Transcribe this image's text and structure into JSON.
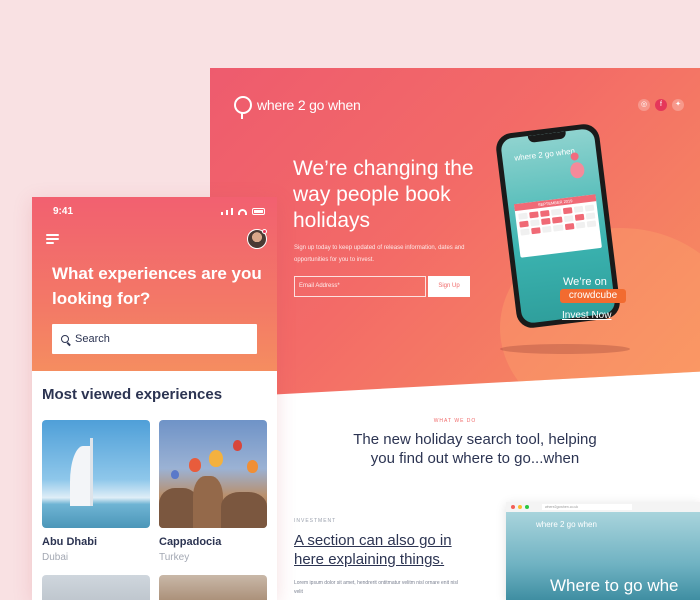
{
  "desktop": {
    "brand": "where 2 go when",
    "socials": [
      "instagram-icon",
      "facebook-icon",
      "twitter-icon"
    ],
    "hero_title": "We’re changing the way people book holidays",
    "hero_sub": "Sign up today to keep updated of release information, dates and opportunities for you to invest.",
    "email_placeholder": "Email Address*",
    "signup_label": "Sign Up",
    "phone_brand": "where 2 go when",
    "calendar_month": "SEPTEMBER 2019",
    "weare": "We’re on",
    "crowdcube": "crowdcube",
    "invest_link": "Invest Now",
    "what_label": "WHAT WE DO",
    "what_title": "The new holiday search tool, helping you find out where to go...when",
    "invest_label": "INVESTMENT",
    "invest_title": "A section can also go in here explaining things.",
    "invest_body": "Lorem ipsum dolor sit amet, hendrerit ontitmatur velitm nisl ornare enit nisl velit",
    "browser_url": "where2gowhen.co.uk",
    "browser_brand": "where 2 go when",
    "browser_big": "Where to go whe"
  },
  "mobile": {
    "time": "9:41",
    "title": "What experiences are you looking for?",
    "search_placeholder": "Search",
    "section_title": "Most viewed experiences",
    "cards": [
      {
        "name": "Abu Dhabi",
        "country": "Dubai"
      },
      {
        "name": "Cappadocia",
        "country": "Turkey"
      }
    ]
  },
  "colors": {
    "accent": "#f06a6a",
    "navy": "#2c3452",
    "background": "#f9e1e3"
  }
}
